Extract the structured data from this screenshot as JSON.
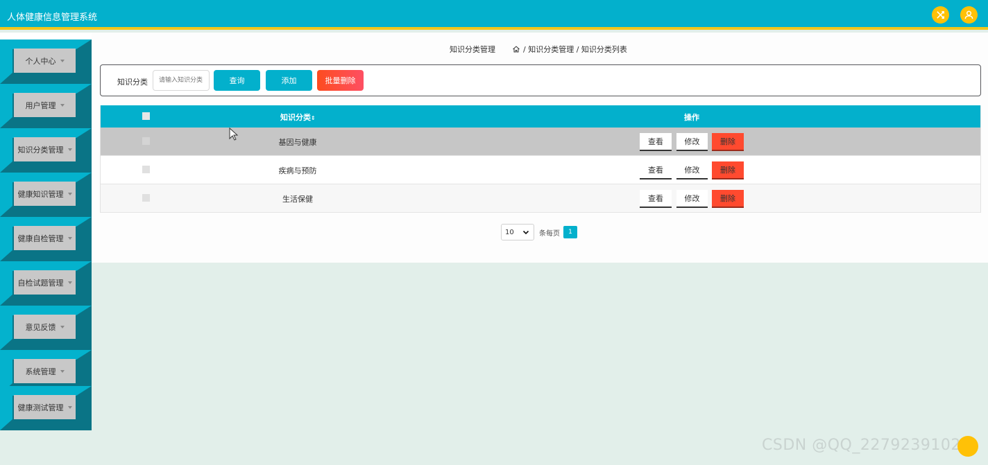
{
  "header": {
    "app_title": "人体健康信息管理系统",
    "accent_color": "#03b0cc",
    "stripe_color": "#f0c61c",
    "icons": [
      "shuffle-icon",
      "user-icon"
    ]
  },
  "sidebar": {
    "items": [
      {
        "label": "个人中心"
      },
      {
        "label": "用户管理"
      },
      {
        "label": "知识分类管理"
      },
      {
        "label": "健康知识管理"
      },
      {
        "label": "健康自检管理"
      },
      {
        "label": "自检试题管理"
      },
      {
        "label": "意见反馈"
      },
      {
        "label": "系统管理"
      },
      {
        "label": "健康测试管理"
      }
    ]
  },
  "breadcrumb": {
    "page_title": "知识分类管理",
    "path": "/ 知识分类管理 / 知识分类列表"
  },
  "search": {
    "label": "知识分类",
    "placeholder": "请输入知识分类",
    "query_label": "查询",
    "add_label": "添加",
    "batch_delete_label": "批量删除"
  },
  "table": {
    "columns": {
      "name": "知识分类",
      "sort_glyph": "⇕",
      "ops": "操作"
    },
    "rows": [
      {
        "name": "基因与健康"
      },
      {
        "name": "疾病与预防"
      },
      {
        "name": "生活保健"
      }
    ],
    "actions": {
      "view": "查看",
      "edit": "修改",
      "delete": "删除"
    }
  },
  "pagination": {
    "page_size": "10",
    "per_page_label": "条每页",
    "current_page": "1"
  },
  "watermark": "CSDN @QQ_2279239102"
}
